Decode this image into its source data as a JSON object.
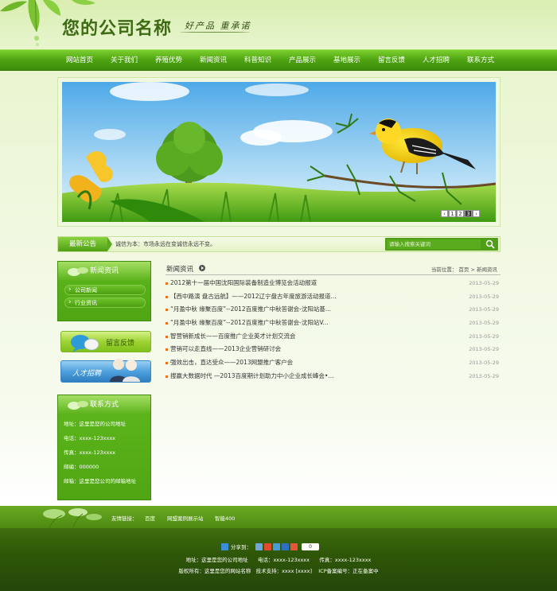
{
  "header": {
    "site_title": "您的公司名称",
    "slogan": "好产品 重承诺"
  },
  "nav": {
    "items": [
      {
        "label": "网站首页"
      },
      {
        "label": "关于我们"
      },
      {
        "label": "养殖优势"
      },
      {
        "label": "新闻资讯"
      },
      {
        "label": "科普知识"
      },
      {
        "label": "产品展示"
      },
      {
        "label": "基地展示"
      },
      {
        "label": "留言反馈"
      },
      {
        "label": "人才招聘"
      },
      {
        "label": "联系方式"
      }
    ]
  },
  "banner": {
    "pages": [
      "1",
      "2",
      "3"
    ],
    "active_page": "3"
  },
  "notice": {
    "label": "最新公告",
    "text": "诚信为本：市场永远在变诚信永远不变。",
    "search_placeholder": "请输入搜索关键词"
  },
  "sidebar": {
    "news_title": "新闻资讯",
    "news_links": [
      {
        "label": "公司新闻"
      },
      {
        "label": "行业资讯"
      }
    ],
    "message_button": "留言反馈",
    "jobs_button": "人才招聘",
    "contact_title": "联系方式",
    "contact_lines": [
      "地址：这里是您的公司地址",
      "电话：xxxx-123xxxx",
      "传真：xxxx-123xxxx",
      "邮编：000000",
      "邮箱：这里是您公司的邮箱地址"
    ]
  },
  "main": {
    "section_title": "新闻资讯",
    "breadcrumb_prefix": "当前位置：",
    "breadcrumb_home": "首页",
    "breadcrumb_sep": ">",
    "breadcrumb_current": "新闻资讯",
    "news": [
      {
        "title": "2012第十一届中国沈阳国际装备制造业博览会活动报道",
        "date": "2013-05-29"
      },
      {
        "title": "【西中路演 盘古远航】——2012辽宁盘古年度旅游活动报道...",
        "date": "2013-05-29"
      },
      {
        "title": "“月盈中秋 缘聚百度”--2012百度推广中秋答谢会-沈阳站基...",
        "date": "2013-05-29"
      },
      {
        "title": "“月盈中秋 缘聚百度”--2012百度推广中秋答谢会-沈阳站V...",
        "date": "2013-05-29"
      },
      {
        "title": "智营销新成长——百度推广企业英才计划交流会",
        "date": "2013-05-29"
      },
      {
        "title": "营销可以走直线——2013企业营销研讨会",
        "date": "2013-05-29"
      },
      {
        "title": "强效出击，直达受众——2013网盟推广客户会",
        "date": "2013-05-29"
      },
      {
        "title": "搜赢大数据时代 —2013百度期计划助力中小企业成长峰会•...",
        "date": "2013-05-29"
      }
    ]
  },
  "links": {
    "label": "友情链接：",
    "items": [
      {
        "label": "百度"
      },
      {
        "label": "网盟案例展示站"
      },
      {
        "label": "智能400"
      }
    ]
  },
  "footer": {
    "share_label": "分享到：",
    "share_count": "0",
    "line1": "地址：这里是您的公司地址      电话：xxxx-123xxxx      传真：xxxx-123xxxx",
    "line2": "版权所有：这里是您的网站名称   技术支持：xxxx [xxxx]    ICP备案编号：正在备案中"
  },
  "colors": {
    "nav_green": "#4ea312",
    "bullet_orange": "#f06e12",
    "footer_dark": "#2f5707"
  }
}
